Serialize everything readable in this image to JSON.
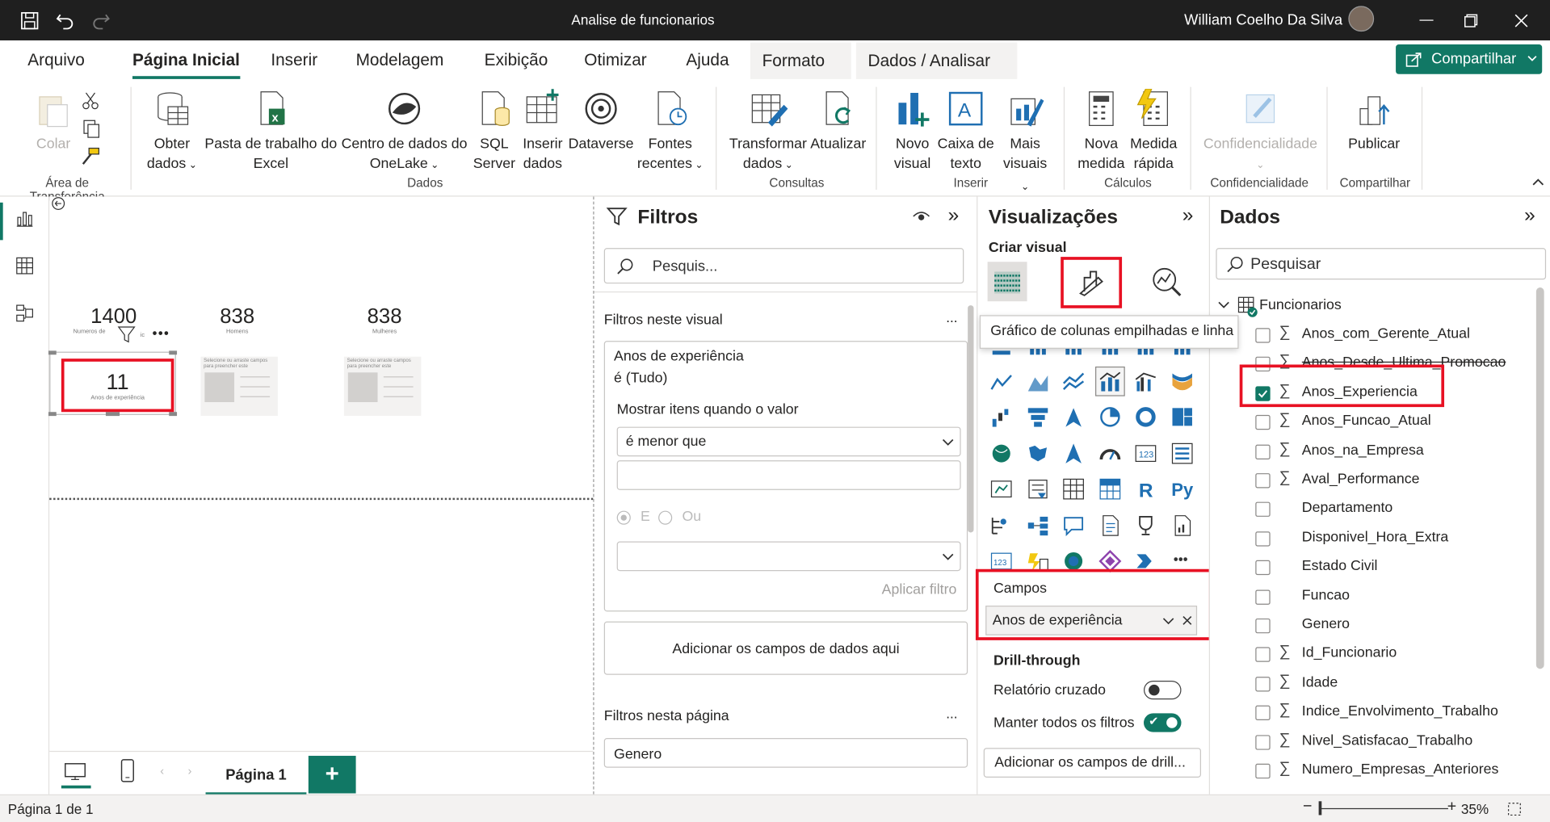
{
  "window": {
    "title": "Analise de funcionarios",
    "user": "William Coelho Da Silva"
  },
  "tabs": [
    {
      "label": "Arquivo"
    },
    {
      "label": "Página Inicial"
    },
    {
      "label": "Inserir"
    },
    {
      "label": "Modelagem"
    },
    {
      "label": "Exibição"
    },
    {
      "label": "Otimizar"
    },
    {
      "label": "Ajuda"
    },
    {
      "label": "Formato"
    },
    {
      "label": "Dados / Analisar"
    }
  ],
  "share_label": "Compartilhar",
  "ribbon": {
    "colar": "Colar",
    "obter1": "Obter",
    "obter2": "dados",
    "pasta1": "Pasta de trabalho do",
    "pasta2": "Excel",
    "centro1": "Centro de dados do",
    "centro2": "OneLake",
    "sql1": "SQL",
    "sql2": "Server",
    "inserir1": "Inserir",
    "inserir2": "dados",
    "dataverse": "Dataverse",
    "fontes1": "Fontes",
    "fontes2": "recentes",
    "transf1": "Transformar",
    "transf2": "dados",
    "atualizar": "Atualizar",
    "novo1": "Novo",
    "novo2": "visual",
    "caixa1": "Caixa de",
    "caixa2": "texto",
    "mais1": "Mais",
    "mais2": "visuais",
    "nova1": "Nova",
    "nova2": "medida",
    "medida1": "Medida",
    "medida2": "rápida",
    "conf": "Confidencialidade",
    "publicar": "Publicar",
    "groups": {
      "transferencia": "Área de Transferência",
      "dados": "Dados",
      "consultas": "Consultas",
      "inserir": "Inserir",
      "calculos": "Cálculos",
      "conf": "Confidencialidade",
      "compartilhar": "Compartilhar"
    }
  },
  "canvas": {
    "cards": [
      {
        "value": "1400",
        "label": "Numeros de"
      },
      {
        "value": "838",
        "label": "Homens"
      },
      {
        "value": "838",
        "label": "Mulheres"
      }
    ],
    "selected_card": {
      "value": "11",
      "label": "Anos de experiência"
    },
    "placeholder_text": "Selecione ou arraste campos para preencher este"
  },
  "pages": {
    "tab": "Página 1",
    "add": "+"
  },
  "filters": {
    "title": "Filtros",
    "search_placeholder": "Pesquis...",
    "section_visual": "Filtros neste visual",
    "card_title": "Anos de experiência",
    "card_state": "é (Tudo)",
    "show_items": "Mostrar itens quando o valor",
    "operator": "é menor que",
    "and_label": "E",
    "or_label": "Ou",
    "apply": "Aplicar filtro",
    "add_fields": "Adicionar os campos de dados aqui",
    "section_page": "Filtros nesta página",
    "page_field": "Genero",
    "more": "..."
  },
  "viz": {
    "title": "Visualizações",
    "create": "Criar visual",
    "tooltip": "Gráfico de colunas empilhadas e linha",
    "fields_title": "Campos",
    "field_value": "Anos de experiência",
    "drill_title": "Drill-through",
    "cross_report": "Relatório cruzado",
    "keep_filters": "Manter todos os filtros",
    "add_drill": "Adicionar os campos de drill...",
    "more": "..."
  },
  "data_pane": {
    "title": "Dados",
    "search_placeholder": "Pesquisar",
    "table": "Funcionarios",
    "fields": [
      {
        "name": "Anos_com_Gerente_Atual",
        "sigma": true,
        "checked": false
      },
      {
        "name": "Anos_Desde_Ultima_Promocao",
        "sigma": true,
        "checked": false
      },
      {
        "name": "Anos_Experiencia",
        "sigma": true,
        "checked": true
      },
      {
        "name": "Anos_Funcao_Atual",
        "sigma": true,
        "checked": false
      },
      {
        "name": "Anos_na_Empresa",
        "sigma": true,
        "checked": false
      },
      {
        "name": "Aval_Performance",
        "sigma": true,
        "checked": false
      },
      {
        "name": "Departamento",
        "sigma": false,
        "checked": false
      },
      {
        "name": "Disponivel_Hora_Extra",
        "sigma": false,
        "checked": false
      },
      {
        "name": "Estado Civil",
        "sigma": false,
        "checked": false
      },
      {
        "name": "Funcao",
        "sigma": false,
        "checked": false
      },
      {
        "name": "Genero",
        "sigma": false,
        "checked": false
      },
      {
        "name": "Id_Funcionario",
        "sigma": true,
        "checked": false
      },
      {
        "name": "Idade",
        "sigma": true,
        "checked": false
      },
      {
        "name": "Indice_Envolvimento_Trabalho",
        "sigma": true,
        "checked": false
      },
      {
        "name": "Nivel_Satisfacao_Trabalho",
        "sigma": true,
        "checked": false
      },
      {
        "name": "Numero_Empresas_Anteriores",
        "sigma": true,
        "checked": false
      }
    ]
  },
  "status": {
    "page": "Página 1 de 1",
    "zoom": "35%"
  },
  "colors": {
    "accent": "#117865",
    "highlight": "#e81123",
    "titlebar": "#1f1f1f"
  }
}
